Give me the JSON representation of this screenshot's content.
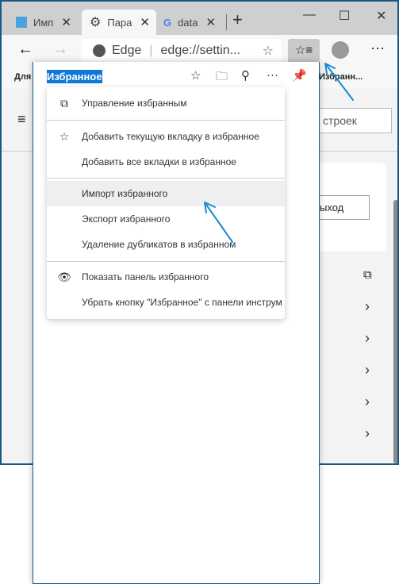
{
  "tabs": [
    {
      "label": "Имп",
      "icon": "page-icon"
    },
    {
      "label": "Пара",
      "icon": "gear-icon"
    },
    {
      "label": "data",
      "icon": "google-icon"
    }
  ],
  "new_tab": "+",
  "window_controls": {
    "minimize": "—",
    "maximize": "☐",
    "close": "✕"
  },
  "address": {
    "brand": "Edge",
    "url": "edge://settin..."
  },
  "favbar": {
    "left": "Для",
    "right": "Избранн..."
  },
  "settings": {
    "search_placeholder": "строек",
    "signout": "ыход"
  },
  "panel": {
    "title": "Избранное"
  },
  "menu": [
    {
      "label": "Управление избранным",
      "icon": "open-external-icon"
    },
    {
      "label": "Добавить текущую вкладку в избранное",
      "icon": "star-add-icon"
    },
    {
      "label": "Добавить все вкладки в избранное",
      "icon": ""
    },
    {
      "label": "Импорт избранного",
      "icon": "",
      "highlighted": true
    },
    {
      "label": "Экспорт избранного",
      "icon": ""
    },
    {
      "label": "Удаление дубликатов в избранном",
      "icon": ""
    },
    {
      "label": "Показать панель избранного",
      "icon": "eye-icon"
    },
    {
      "label": "Убрать кнопку \"Избранное\" с панели инструм",
      "icon": ""
    }
  ],
  "colors": {
    "accent": "#0f78d4",
    "window_border": "#155a86",
    "annotation_arrow": "#1a8ad4"
  }
}
